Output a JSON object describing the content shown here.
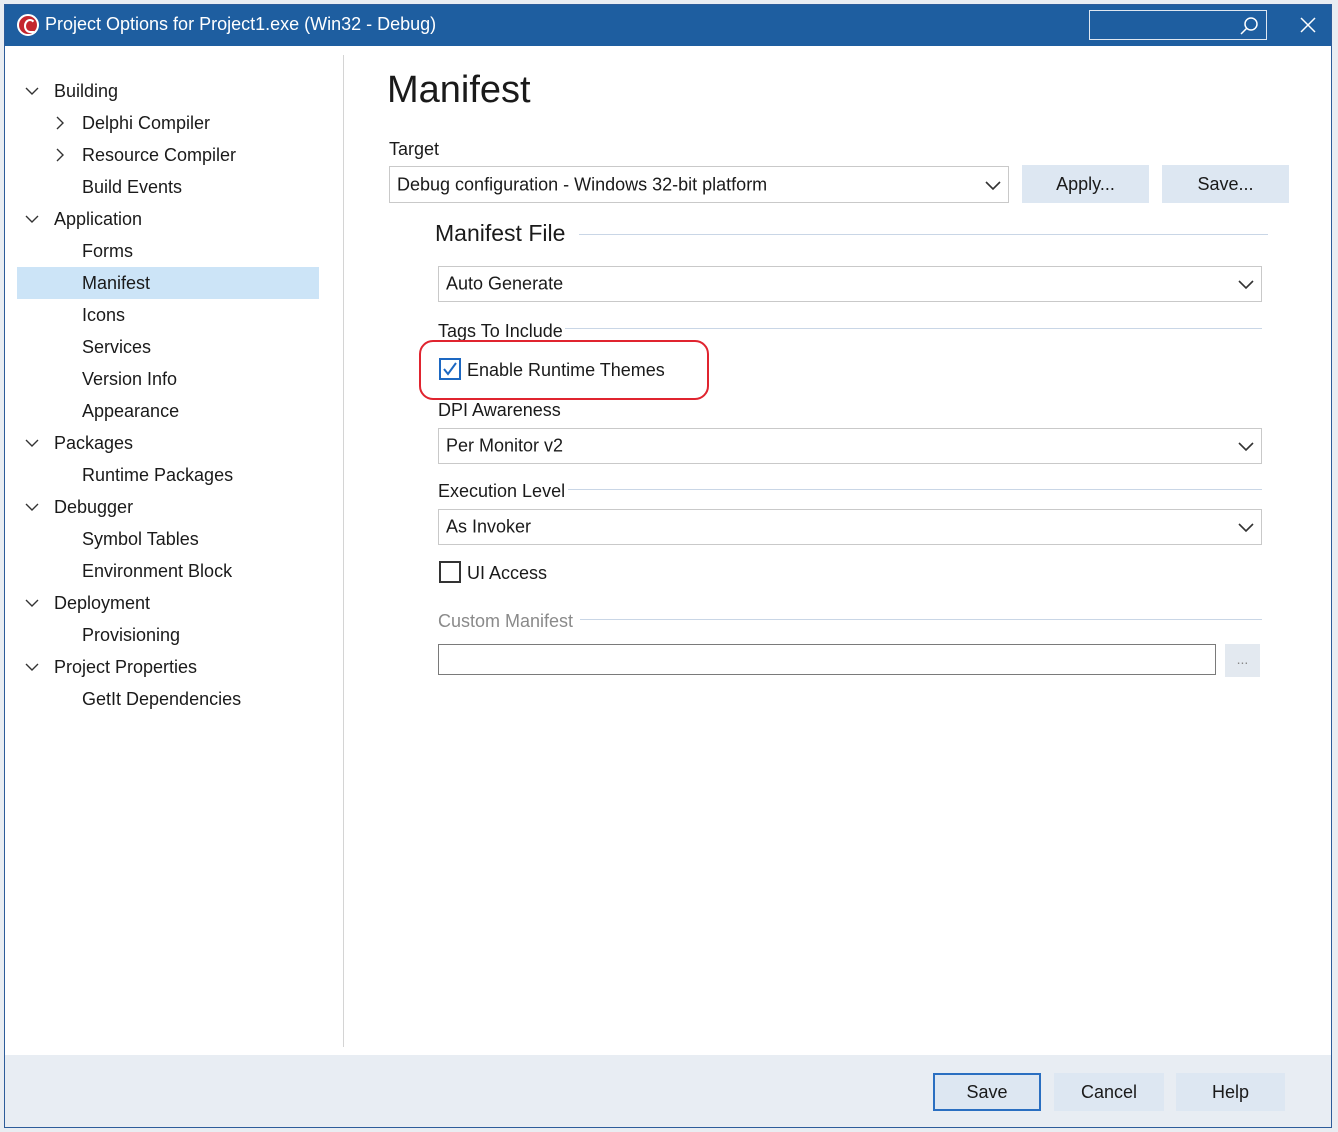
{
  "window": {
    "title": "Project Options for Project1.exe  (Win32 - Debug)",
    "search_placeholder": ""
  },
  "sidebar": {
    "items": [
      {
        "label": "Building",
        "level": 0,
        "expanded": true
      },
      {
        "label": "Delphi Compiler",
        "level": 1,
        "collapsed": true
      },
      {
        "label": "Resource Compiler",
        "level": 1,
        "collapsed": true
      },
      {
        "label": "Build Events",
        "level": 1
      },
      {
        "label": "Application",
        "level": 0,
        "expanded": true
      },
      {
        "label": "Forms",
        "level": 1
      },
      {
        "label": "Manifest",
        "level": 1,
        "selected": true
      },
      {
        "label": "Icons",
        "level": 1
      },
      {
        "label": "Services",
        "level": 1
      },
      {
        "label": "Version Info",
        "level": 1
      },
      {
        "label": "Appearance",
        "level": 1
      },
      {
        "label": "Packages",
        "level": 0,
        "expanded": true
      },
      {
        "label": "Runtime Packages",
        "level": 1
      },
      {
        "label": "Debugger",
        "level": 0,
        "expanded": true
      },
      {
        "label": "Symbol Tables",
        "level": 1
      },
      {
        "label": "Environment Block",
        "level": 1
      },
      {
        "label": "Deployment",
        "level": 0,
        "expanded": true
      },
      {
        "label": "Provisioning",
        "level": 1
      },
      {
        "label": "Project Properties",
        "level": 0,
        "expanded": true
      },
      {
        "label": "GetIt Dependencies",
        "level": 1
      }
    ]
  },
  "main": {
    "title": "Manifest",
    "target_label": "Target",
    "target_value": "Debug configuration - Windows 32-bit platform",
    "apply_label": "Apply...",
    "save_target_label": "Save...",
    "manifest_file_heading": "Manifest File",
    "manifest_file_value": "Auto Generate",
    "tags_heading": "Tags To Include",
    "enable_runtime_themes_label": "Enable Runtime Themes",
    "enable_runtime_themes_checked": true,
    "dpi_heading": "DPI Awareness",
    "dpi_value": "Per Monitor v2",
    "execution_heading": "Execution Level",
    "execution_value": "As Invoker",
    "ui_access_label": "UI Access",
    "ui_access_checked": false,
    "custom_manifest_heading": "Custom Manifest",
    "custom_manifest_value": "",
    "browse_label": "..."
  },
  "footer": {
    "save_label": "Save",
    "cancel_label": "Cancel",
    "help_label": "Help"
  },
  "colors": {
    "titlebar": "#1e5ea0",
    "selection": "#cce4f7",
    "accent": "#1d68c2",
    "highlight": "#e0242f"
  }
}
